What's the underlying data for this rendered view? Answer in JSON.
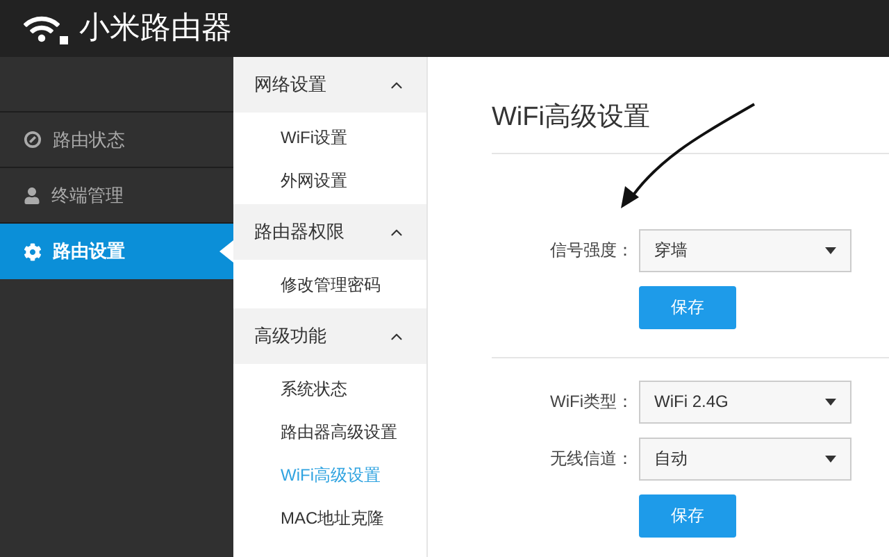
{
  "header": {
    "title": "小米路由器"
  },
  "sidebar": {
    "items": [
      {
        "label": "路由状态",
        "kind": "status",
        "selected": false
      },
      {
        "label": "终端管理",
        "kind": "user",
        "selected": false
      },
      {
        "label": "路由设置",
        "kind": "gear",
        "selected": true
      }
    ]
  },
  "submenu": {
    "sections": [
      {
        "title": "网络设置",
        "expanded": true,
        "items": [
          {
            "label": "WiFi设置",
            "selected": false
          },
          {
            "label": "外网设置",
            "selected": false
          }
        ]
      },
      {
        "title": "路由器权限",
        "expanded": true,
        "items": [
          {
            "label": "修改管理密码",
            "selected": false
          }
        ]
      },
      {
        "title": "高级功能",
        "expanded": true,
        "items": [
          {
            "label": "系统状态",
            "selected": false
          },
          {
            "label": "路由器高级设置",
            "selected": false
          },
          {
            "label": "WiFi高级设置",
            "selected": true
          },
          {
            "label": "MAC地址克隆",
            "selected": false
          }
        ]
      }
    ]
  },
  "main": {
    "title": "WiFi高级设置",
    "forms": [
      {
        "fields": [
          {
            "label": "信号强度：",
            "value": "穿墙"
          }
        ],
        "button": "保存"
      },
      {
        "fields": [
          {
            "label": "WiFi类型：",
            "value": "WiFi 2.4G"
          },
          {
            "label": "无线信道：",
            "value": "自动"
          }
        ],
        "button": "保存"
      }
    ]
  }
}
